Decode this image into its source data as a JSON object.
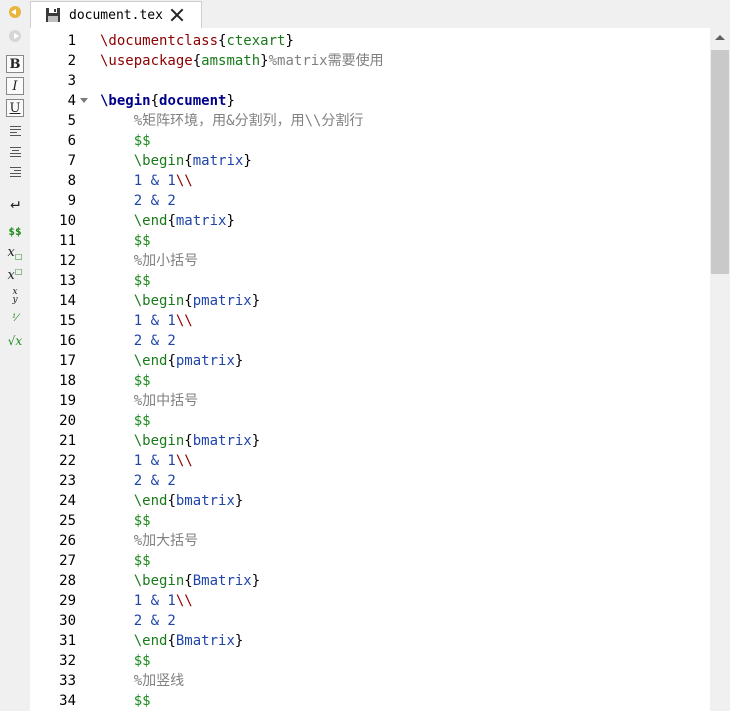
{
  "tab": {
    "title": "document.tex"
  },
  "toolbar": {
    "bold": "B",
    "italic": "I",
    "underline": "U",
    "math_inline": "$$",
    "subscript": "x",
    "superscript": "x",
    "fraction_num": "x",
    "fraction_den": "y",
    "sqrt": "√x"
  },
  "lines": [
    {
      "n": "1",
      "parts": [
        [
          "cmd",
          "\\documentclass"
        ],
        [
          "plain",
          "{"
        ],
        [
          "arg",
          "ctexart"
        ],
        [
          "plain",
          "}"
        ]
      ]
    },
    {
      "n": "2",
      "parts": [
        [
          "cmd",
          "\\usepackage"
        ],
        [
          "plain",
          "{"
        ],
        [
          "arg",
          "amsmath"
        ],
        [
          "plain",
          "}"
        ],
        [
          "comment",
          "%matrix需要使用"
        ]
      ]
    },
    {
      "n": "3",
      "parts": []
    },
    {
      "n": "4",
      "fold": true,
      "parts": [
        [
          "kw",
          "\\begin"
        ],
        [
          "plain",
          "{"
        ],
        [
          "kw",
          "document"
        ],
        [
          "plain",
          "}"
        ]
      ]
    },
    {
      "n": "5",
      "parts": [
        [
          "plain",
          "    "
        ],
        [
          "comment",
          "%矩阵环境，用&分割列，用\\\\分割行"
        ]
      ]
    },
    {
      "n": "6",
      "parts": [
        [
          "plain",
          "    "
        ],
        [
          "math",
          "$$"
        ]
      ]
    },
    {
      "n": "7",
      "parts": [
        [
          "plain",
          "    "
        ],
        [
          "arg",
          "\\begin"
        ],
        [
          "plain",
          "{"
        ],
        [
          "blue",
          "matrix"
        ],
        [
          "plain",
          "}"
        ]
      ]
    },
    {
      "n": "8",
      "parts": [
        [
          "plain",
          "    "
        ],
        [
          "num",
          "1 & 1"
        ],
        [
          "cmd",
          "\\\\"
        ]
      ]
    },
    {
      "n": "9",
      "parts": [
        [
          "plain",
          "    "
        ],
        [
          "num",
          "2 & 2"
        ]
      ]
    },
    {
      "n": "10",
      "parts": [
        [
          "plain",
          "    "
        ],
        [
          "arg",
          "\\end"
        ],
        [
          "plain",
          "{"
        ],
        [
          "blue",
          "matrix"
        ],
        [
          "plain",
          "}"
        ]
      ]
    },
    {
      "n": "11",
      "parts": [
        [
          "plain",
          "    "
        ],
        [
          "math",
          "$$"
        ]
      ]
    },
    {
      "n": "12",
      "parts": [
        [
          "plain",
          "    "
        ],
        [
          "comment",
          "%加小括号"
        ]
      ]
    },
    {
      "n": "13",
      "parts": [
        [
          "plain",
          "    "
        ],
        [
          "math",
          "$$"
        ]
      ]
    },
    {
      "n": "14",
      "parts": [
        [
          "plain",
          "    "
        ],
        [
          "arg",
          "\\begin"
        ],
        [
          "plain",
          "{"
        ],
        [
          "blue",
          "pmatrix"
        ],
        [
          "plain",
          "}"
        ]
      ]
    },
    {
      "n": "15",
      "parts": [
        [
          "plain",
          "    "
        ],
        [
          "num",
          "1 & 1"
        ],
        [
          "cmd",
          "\\\\"
        ]
      ]
    },
    {
      "n": "16",
      "parts": [
        [
          "plain",
          "    "
        ],
        [
          "num",
          "2 & 2"
        ]
      ]
    },
    {
      "n": "17",
      "parts": [
        [
          "plain",
          "    "
        ],
        [
          "arg",
          "\\end"
        ],
        [
          "plain",
          "{"
        ],
        [
          "blue",
          "pmatrix"
        ],
        [
          "plain",
          "}"
        ]
      ]
    },
    {
      "n": "18",
      "parts": [
        [
          "plain",
          "    "
        ],
        [
          "math",
          "$$"
        ]
      ]
    },
    {
      "n": "19",
      "parts": [
        [
          "plain",
          "    "
        ],
        [
          "comment",
          "%加中括号"
        ]
      ]
    },
    {
      "n": "20",
      "parts": [
        [
          "plain",
          "    "
        ],
        [
          "math",
          "$$"
        ]
      ]
    },
    {
      "n": "21",
      "parts": [
        [
          "plain",
          "    "
        ],
        [
          "arg",
          "\\begin"
        ],
        [
          "plain",
          "{"
        ],
        [
          "blue",
          "bmatrix"
        ],
        [
          "plain",
          "}"
        ]
      ]
    },
    {
      "n": "22",
      "parts": [
        [
          "plain",
          "    "
        ],
        [
          "num",
          "1 & 1"
        ],
        [
          "cmd",
          "\\\\"
        ]
      ]
    },
    {
      "n": "23",
      "parts": [
        [
          "plain",
          "    "
        ],
        [
          "num",
          "2 & 2"
        ]
      ]
    },
    {
      "n": "24",
      "parts": [
        [
          "plain",
          "    "
        ],
        [
          "arg",
          "\\end"
        ],
        [
          "plain",
          "{"
        ],
        [
          "blue",
          "bmatrix"
        ],
        [
          "plain",
          "}"
        ]
      ]
    },
    {
      "n": "25",
      "parts": [
        [
          "plain",
          "    "
        ],
        [
          "math",
          "$$"
        ]
      ]
    },
    {
      "n": "26",
      "parts": [
        [
          "plain",
          "    "
        ],
        [
          "comment",
          "%加大括号"
        ]
      ]
    },
    {
      "n": "27",
      "parts": [
        [
          "plain",
          "    "
        ],
        [
          "math",
          "$$"
        ]
      ]
    },
    {
      "n": "28",
      "parts": [
        [
          "plain",
          "    "
        ],
        [
          "arg",
          "\\begin"
        ],
        [
          "plain",
          "{"
        ],
        [
          "blue",
          "Bmatrix"
        ],
        [
          "plain",
          "}"
        ]
      ]
    },
    {
      "n": "29",
      "parts": [
        [
          "plain",
          "    "
        ],
        [
          "num",
          "1 & 1"
        ],
        [
          "cmd",
          "\\\\"
        ]
      ]
    },
    {
      "n": "30",
      "parts": [
        [
          "plain",
          "    "
        ],
        [
          "num",
          "2 & 2"
        ]
      ]
    },
    {
      "n": "31",
      "parts": [
        [
          "plain",
          "    "
        ],
        [
          "arg",
          "\\end"
        ],
        [
          "plain",
          "{"
        ],
        [
          "blue",
          "Bmatrix"
        ],
        [
          "plain",
          "}"
        ]
      ]
    },
    {
      "n": "32",
      "parts": [
        [
          "plain",
          "    "
        ],
        [
          "math",
          "$$"
        ]
      ]
    },
    {
      "n": "33",
      "parts": [
        [
          "plain",
          "    "
        ],
        [
          "comment",
          "%加竖线"
        ]
      ]
    },
    {
      "n": "34",
      "parts": [
        [
          "plain",
          "    "
        ],
        [
          "math",
          "$$"
        ]
      ]
    }
  ]
}
